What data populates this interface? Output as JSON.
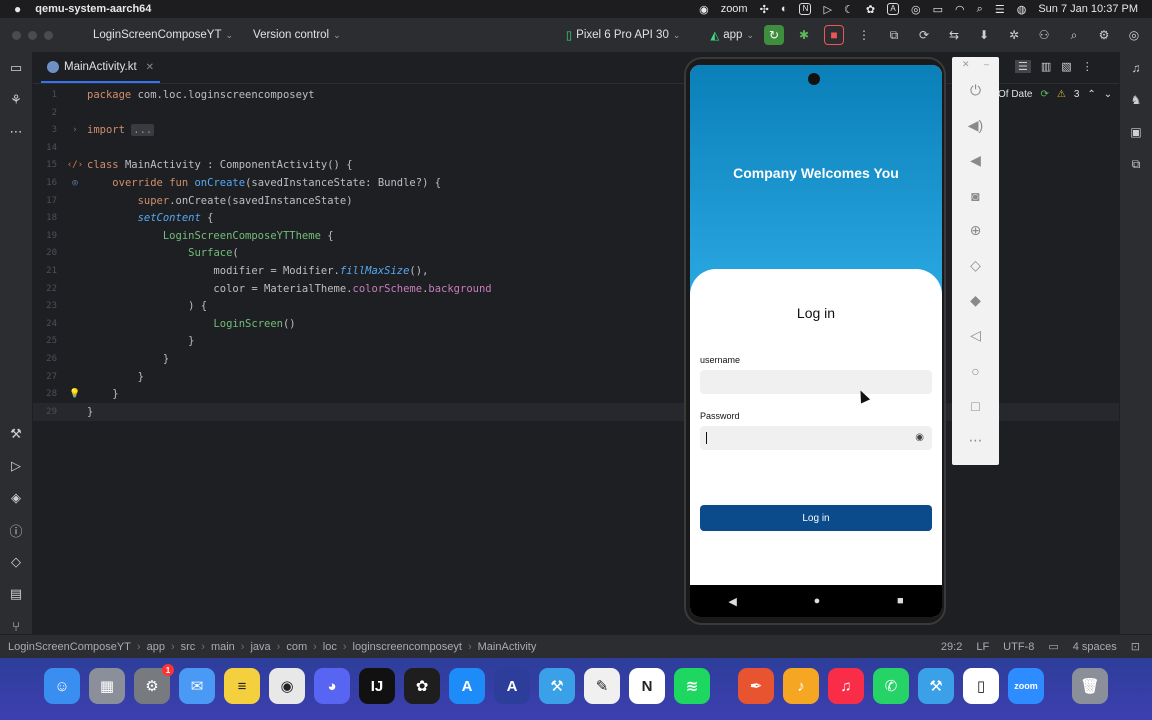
{
  "menubar": {
    "app_name": "qemu-system-aarch64",
    "zoom_label": "zoom",
    "clock": "Sun 7 Jan  10:37 PM"
  },
  "toolbar": {
    "project": "LoginScreenComposeYT",
    "vcs": "Version control",
    "device": "Pixel 6 Pro API 30",
    "run_config": "app"
  },
  "editor": {
    "tab_label": "MainActivity.kt",
    "out_of_date": "Of Date",
    "warnings_count": "3",
    "lines": [
      {
        "n": "1",
        "parts": [
          [
            "kw",
            "package "
          ],
          [
            "cls",
            "com.loc.loginscreencomposeyt"
          ]
        ]
      },
      {
        "n": "2",
        "parts": []
      },
      {
        "n": "3",
        "parts": [
          [
            "kw",
            "import "
          ],
          [
            "fold",
            "..."
          ]
        ]
      },
      {
        "n": "14",
        "parts": []
      },
      {
        "n": "15",
        "parts": [
          [
            "kw",
            "class "
          ],
          [
            "cls",
            "MainActivity : ComponentActivity() {"
          ]
        ]
      },
      {
        "n": "16",
        "parts": [
          [
            "cls",
            "    "
          ],
          [
            "kw",
            "override fun "
          ],
          [
            "fn",
            "onCreate"
          ],
          [
            "cls",
            "(savedInstanceState: Bundle?) {"
          ]
        ]
      },
      {
        "n": "17",
        "parts": [
          [
            "cls",
            "        "
          ],
          [
            "kw",
            "super"
          ],
          [
            "cls",
            ".onCreate(savedInstanceState)"
          ]
        ]
      },
      {
        "n": "18",
        "parts": [
          [
            "cls",
            "        "
          ],
          [
            "it",
            "setContent"
          ],
          [
            "cls",
            " {"
          ]
        ]
      },
      {
        "n": "19",
        "parts": [
          [
            "cls",
            "            "
          ],
          [
            "grn",
            "LoginScreenComposeYTTheme"
          ],
          [
            "cls",
            " {"
          ]
        ]
      },
      {
        "n": "20",
        "parts": [
          [
            "cls",
            "                "
          ],
          [
            "grn",
            "Surface"
          ],
          [
            "cls",
            "("
          ]
        ]
      },
      {
        "n": "21",
        "parts": [
          [
            "cls",
            "                    modifier = Modifier."
          ],
          [
            "it",
            "fillMaxSize"
          ],
          [
            "cls",
            "(),"
          ]
        ]
      },
      {
        "n": "22",
        "parts": [
          [
            "cls",
            "                    color = MaterialTheme."
          ],
          [
            "prop",
            "colorScheme"
          ],
          [
            "cls",
            "."
          ],
          [
            "prop",
            "background"
          ]
        ]
      },
      {
        "n": "23",
        "parts": [
          [
            "cls",
            "                ) {"
          ]
        ]
      },
      {
        "n": "24",
        "parts": [
          [
            "cls",
            "                    "
          ],
          [
            "grn",
            "LoginScreen"
          ],
          [
            "cls",
            "()"
          ]
        ]
      },
      {
        "n": "25",
        "parts": [
          [
            "cls",
            "                }"
          ]
        ]
      },
      {
        "n": "26",
        "parts": [
          [
            "cls",
            "            }"
          ]
        ]
      },
      {
        "n": "27",
        "parts": [
          [
            "cls",
            "        }"
          ]
        ]
      },
      {
        "n": "28",
        "parts": [
          [
            "cls",
            "    }"
          ]
        ]
      },
      {
        "n": "29",
        "parts": [
          [
            "cls",
            "}"
          ]
        ]
      }
    ]
  },
  "emulator": {
    "welcome": "Company Welcomes You",
    "login_title": "Log in",
    "username_label": "username",
    "password_label": "Password",
    "login_button": "Log in"
  },
  "statusbar": {
    "crumbs": [
      "LoginScreenComposeYT",
      "app",
      "src",
      "main",
      "java",
      "com",
      "loc",
      "loginscreencomposeyt",
      "MainActivity"
    ],
    "position": "29:2",
    "line_ending": "LF",
    "encoding": "UTF-8",
    "indent": "4 spaces"
  },
  "dock": {
    "items": [
      {
        "name": "finder",
        "color": "#3a8ef0",
        "glyph": "☺"
      },
      {
        "name": "launchpad",
        "color": "#8a8f99",
        "glyph": "▦"
      },
      {
        "name": "system-settings",
        "color": "#777b80",
        "glyph": "⚙",
        "badge": "1"
      },
      {
        "name": "mail",
        "color": "#4a9af5",
        "glyph": "✉"
      },
      {
        "name": "notes",
        "color": "#f4d03f",
        "glyph": "≡"
      },
      {
        "name": "chrome",
        "color": "#e8e8e8",
        "glyph": "◉"
      },
      {
        "name": "discord",
        "color": "#5865f2",
        "glyph": "◕"
      },
      {
        "name": "intellij",
        "color": "#111111",
        "glyph": "IJ"
      },
      {
        "name": "figma",
        "color": "#1e1e1e",
        "glyph": "✿"
      },
      {
        "name": "app-store",
        "color": "#1d8cf8",
        "glyph": "A"
      },
      {
        "name": "android-studio",
        "color": "#2d3e9a",
        "glyph": "A"
      },
      {
        "name": "xcode",
        "color": "#3aa0e8",
        "glyph": "⚒"
      },
      {
        "name": "textedit",
        "color": "#f0f0f0",
        "glyph": "✎"
      },
      {
        "name": "notion",
        "color": "#ffffff",
        "glyph": "N"
      },
      {
        "name": "spotify",
        "color": "#1ed760",
        "glyph": "≋"
      },
      {
        "name": "pen-app",
        "color": "#e8542f",
        "glyph": "✒"
      },
      {
        "name": "audio-app",
        "color": "#f5a623",
        "glyph": "♪"
      },
      {
        "name": "music",
        "color": "#fa2d48",
        "glyph": "♫"
      },
      {
        "name": "whatsapp",
        "color": "#25d366",
        "glyph": "✆"
      },
      {
        "name": "xcode-2",
        "color": "#3aa0e8",
        "glyph": "⚒"
      },
      {
        "name": "android-emulator",
        "color": "#ffffff",
        "glyph": "▯"
      },
      {
        "name": "zoom",
        "color": "#2d8cff",
        "glyph": "zoom"
      },
      {
        "name": "trash",
        "color": "#8a8f99",
        "glyph": "🗑"
      }
    ]
  }
}
